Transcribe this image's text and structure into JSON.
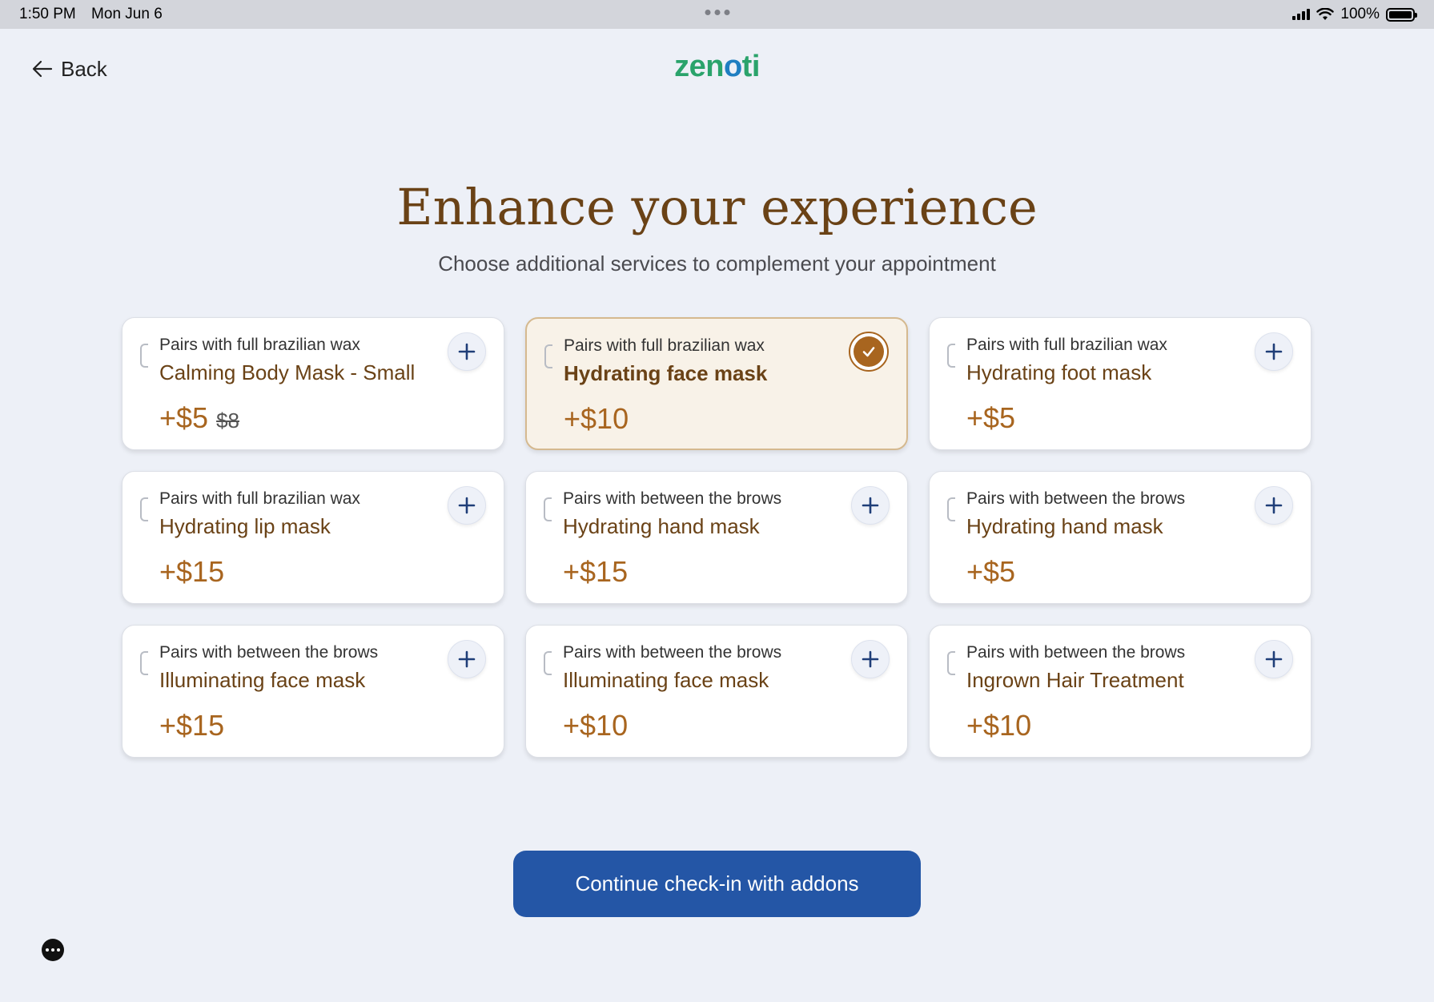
{
  "status_bar": {
    "time": "1:50 PM",
    "date": "Mon Jun 6",
    "battery": "100%"
  },
  "header": {
    "back_label": "Back",
    "logo_text": "zen",
    "logo_o": "o",
    "logo_end": "ti",
    "logo_colors": {
      "main": "#2aa36b",
      "accent": "#1f7ec1"
    }
  },
  "main": {
    "title": "Enhance your experience",
    "subtitle": "Choose additional services to complement your appointment"
  },
  "addons": [
    {
      "pairs": "Pairs with full brazilian wax",
      "name": "Calming Body Mask - Small",
      "price": "+$5",
      "old_price": "$8",
      "selected": false
    },
    {
      "pairs": "Pairs with full brazilian wax",
      "name": "Hydrating face mask",
      "price": "+$10",
      "old_price": "",
      "selected": true
    },
    {
      "pairs": "Pairs with full brazilian wax",
      "name": "Hydrating foot mask",
      "price": "+$5",
      "old_price": "",
      "selected": false
    },
    {
      "pairs": "Pairs with full brazilian wax",
      "name": "Hydrating lip mask",
      "price": "+$15",
      "old_price": "",
      "selected": false
    },
    {
      "pairs": "Pairs with between the brows",
      "name": "Hydrating hand mask",
      "price": "+$15",
      "old_price": "",
      "selected": false
    },
    {
      "pairs": "Pairs with between the brows",
      "name": "Hydrating hand mask",
      "price": "+$5",
      "old_price": "",
      "selected": false
    },
    {
      "pairs": "Pairs with between the brows",
      "name": "Illuminating face mask",
      "price": "+$15",
      "old_price": "",
      "selected": false
    },
    {
      "pairs": "Pairs with between the brows",
      "name": "Illuminating face mask",
      "price": "+$10",
      "old_price": "",
      "selected": false
    },
    {
      "pairs": "Pairs with between the brows",
      "name": "Ingrown Hair Treatment",
      "price": "+$10",
      "old_price": "",
      "selected": false
    }
  ],
  "footer": {
    "continue_label": "Continue check-in with addons"
  },
  "colors": {
    "accent_brown": "#a8651f",
    "title_brown": "#6a4216",
    "primary_blue": "#2456a6"
  }
}
